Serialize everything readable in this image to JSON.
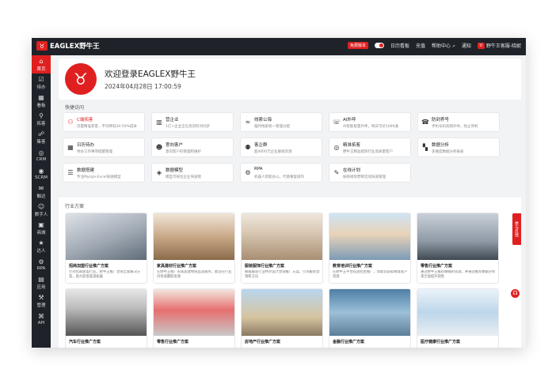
{
  "brand": {
    "name": "EAGLEX野牛王",
    "logo_char": "♉"
  },
  "topbar": {
    "version_tag": "免费版本",
    "links": [
      "日历看板",
      "充值",
      "帮助中心",
      "通知"
    ],
    "user_name": "野牛王客服-晓妮"
  },
  "sidebar": {
    "items": [
      {
        "label": "首页",
        "icon": "home-icon",
        "glyph": "⌂"
      },
      {
        "label": "待办",
        "icon": "todo-icon",
        "glyph": "☑"
      },
      {
        "label": "看板",
        "icon": "board-icon",
        "glyph": "▦"
      },
      {
        "label": "拓客",
        "icon": "leads-icon",
        "glyph": "⚲"
      },
      {
        "label": "集客",
        "icon": "collect-icon",
        "glyph": "☍"
      },
      {
        "label": "CRM",
        "icon": "crm-icon",
        "glyph": "◎"
      },
      {
        "label": "SCRM",
        "icon": "scrm-icon",
        "glyph": "◉"
      },
      {
        "label": "触达",
        "icon": "reach-icon",
        "glyph": "✉"
      },
      {
        "label": "数字人",
        "icon": "digital-human-icon",
        "glyph": "☺"
      },
      {
        "label": "商城",
        "icon": "mall-icon",
        "glyph": "▣"
      },
      {
        "label": "达人",
        "icon": "influencer-icon",
        "glyph": "★"
      },
      {
        "label": "RPA",
        "icon": "rpa-icon",
        "glyph": "⚙"
      },
      {
        "label": "应用",
        "icon": "apps-icon",
        "glyph": "▤"
      },
      {
        "label": "管理",
        "icon": "admin-icon",
        "glyph": "⚒"
      },
      {
        "label": "API",
        "icon": "api-icon",
        "glyph": "⌘"
      }
    ]
  },
  "welcome": {
    "title": "欢迎登录EAGLEX野牛王",
    "datetime": "2024年04月28日 17:00:59"
  },
  "quick_access": {
    "title": "快捷访问",
    "items": [
      {
        "title": "C端拓客",
        "desc": "流量精准获客，平均降低30-50%成本",
        "icon": "users-icon",
        "glyph": "⚇",
        "highlight": true
      },
      {
        "title": "营企业",
        "desc": "1亿+企业全信息资料对同步",
        "icon": "building-icon",
        "glyph": "▥",
        "highlight": false
      },
      {
        "title": "线索公海",
        "desc": "临时线索统一管理分配",
        "icon": "sea-icon",
        "glyph": "≈",
        "highlight": false
      },
      {
        "title": "AI外呼",
        "desc": "AI智能批量外呼，每日可达1000通",
        "icon": "ai-call-icon",
        "glyph": "☏",
        "highlight": false
      },
      {
        "title": "防封养号",
        "desc": "手机号码高频外呼，防止停机",
        "icon": "phone-icon",
        "glyph": "☎",
        "highlight": false
      },
      {
        "title": "日历待办",
        "desc": "待办工作事项提醒管理",
        "icon": "calendar-icon",
        "glyph": "▦",
        "highlight": false
      },
      {
        "title": "意向客户",
        "desc": "意向客户的管理和维护",
        "icon": "customer-icon",
        "glyph": "☻",
        "highlight": false
      },
      {
        "title": "客企群",
        "desc": "超4000万企业群组资源",
        "icon": "group-icon",
        "glyph": "⚉",
        "highlight": false
      },
      {
        "title": "精准拓客",
        "desc": "野牛王精准提炼行业高质量客户",
        "icon": "target-icon",
        "glyph": "◎",
        "highlight": false
      },
      {
        "title": "数据分析",
        "desc": "多维度数据分析报表",
        "icon": "chart-icon",
        "glyph": "▚",
        "highlight": false
      },
      {
        "title": "数据搭建",
        "desc": "专注Mysql+Excel快速模型",
        "icon": "database-icon",
        "glyph": "☰",
        "highlight": false
      },
      {
        "title": "数据模型",
        "desc": "模型可视化企业驾驶舱",
        "icon": "model-icon",
        "glyph": "◈",
        "highlight": false
      },
      {
        "title": "RPA",
        "desc": "机器人智能办公，代替重复操作",
        "icon": "robot-icon",
        "glyph": "⚙",
        "highlight": false
      },
      {
        "title": "在线计划",
        "desc": "按照规划营销活动快速管理",
        "icon": "plan-icon",
        "glyph": "✎",
        "highlight": false
      }
    ]
  },
  "solutions": {
    "title": "行业方案",
    "items": [
      {
        "title": "招商加盟行业推广方案",
        "desc": "针对招商加盟行业，野牛王推广营销全套解决方案，助力获客渠道拓展",
        "image": "img-finance"
      },
      {
        "title": "家具建材行业推广方案",
        "desc": "在野牛王推广的家居建材商品及服务，助您在行业内快速赢取客源",
        "image": "img-furniture"
      },
      {
        "title": "服装服饰行业推广方案",
        "desc": "根据服装行业特点设计营销推广方案，引领服装营销新方向",
        "image": "img-clothing"
      },
      {
        "title": "教育培训行业推广方案",
        "desc": "在野牛王平台投放招生推广，帮助您获取精准客户资源",
        "image": "img-edu"
      },
      {
        "title": "零售行业推广方案",
        "desc": "通过野牛王推荐精确的资源，并通过推荐数据分析来全面提升销售",
        "image": "img-train"
      },
      {
        "title": "汽车行业推广方案",
        "desc": "",
        "image": "img-auto"
      },
      {
        "title": "零售行业推广方案",
        "desc": "",
        "image": "img-retail"
      },
      {
        "title": "房地产行业推广方案",
        "desc": "",
        "image": "img-estate"
      },
      {
        "title": "金融行业推广方案",
        "desc": "",
        "image": "img-fin2"
      },
      {
        "title": "医疗健康行业推广方案",
        "desc": "",
        "image": "img-med"
      }
    ]
  },
  "float_tab": {
    "label": "参与反馈"
  },
  "float_help": {
    "glyph": "☊"
  },
  "colors": {
    "accent": "#e02020",
    "dark": "#1f2329"
  }
}
